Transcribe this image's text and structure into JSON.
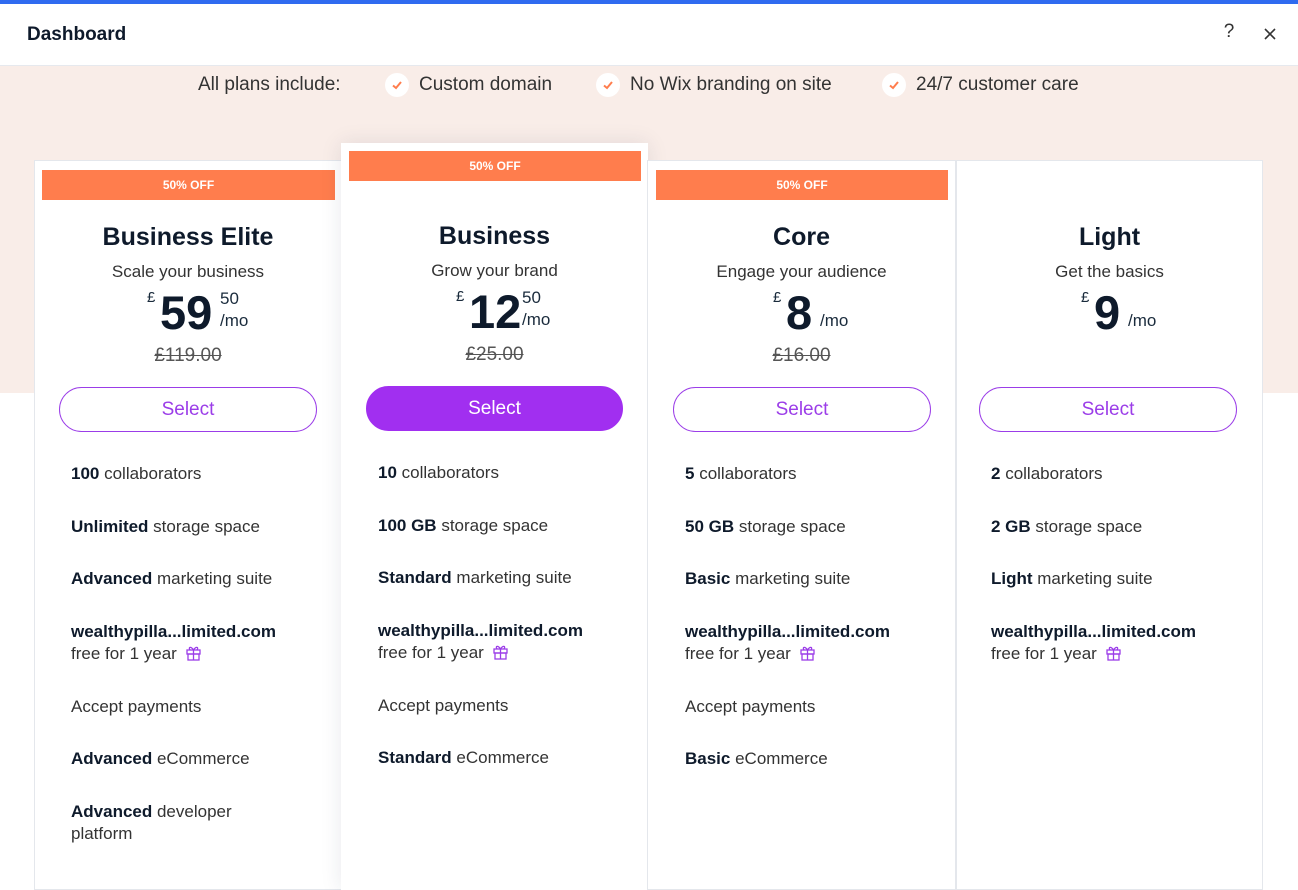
{
  "header": {
    "title": "Dashboard",
    "help": "?"
  },
  "includes": {
    "lead": "All plans include:",
    "items": [
      "Custom domain",
      "No Wix branding on site",
      "24/7 customer care"
    ]
  },
  "colors": {
    "badge": "#ff7d4d",
    "accent": "#a12ff0",
    "hero": "#f9ede8"
  },
  "plans": [
    {
      "badge": "50% OFF",
      "name": "Business Elite",
      "tagline": "Scale your business",
      "currency": "£",
      "price": "59",
      "cents": "50",
      "per": "/mo",
      "old_price": "£119.00",
      "cta": "Select",
      "f1b": "100",
      "f1": " collaborators",
      "f2b": "Unlimited",
      "f2": " storage space",
      "f3b": "Advanced",
      "f3": " marketing suite",
      "domain": "wealthypilla...limited.com",
      "domain_note": "free for 1 year",
      "payments": "Accept payments",
      "f5b": "Advanced",
      "f5": " eCommerce",
      "f6b": "Advanced",
      "f6": " developer platform"
    },
    {
      "badge": "50% OFF",
      "name": "Business",
      "tagline": "Grow your brand",
      "currency": "£",
      "price": "12",
      "cents": "50",
      "per": "/mo",
      "old_price": "£25.00",
      "cta": "Select",
      "f1b": "10",
      "f1": " collaborators",
      "f2b": "100 GB",
      "f2": " storage space",
      "f3b": "Standard",
      "f3": " marketing suite",
      "domain": "wealthypilla...limited.com",
      "domain_note": "free for 1 year",
      "payments": "Accept payments",
      "f5b": "Standard",
      "f5": " eCommerce"
    },
    {
      "badge": "50% OFF",
      "name": "Core",
      "tagline": "Engage your audience",
      "currency": "£",
      "price": "8",
      "per": "/mo",
      "old_price": "£16.00",
      "cta": "Select",
      "f1b": "5",
      "f1": " collaborators",
      "f2b": "50 GB",
      "f2": " storage space",
      "f3b": "Basic",
      "f3": " marketing suite",
      "domain": "wealthypilla...limited.com",
      "domain_note": "free for 1 year",
      "payments": "Accept payments",
      "f5b": "Basic",
      "f5": " eCommerce"
    },
    {
      "name": "Light",
      "tagline": "Get the basics",
      "currency": "£",
      "price": "9",
      "per": "/mo",
      "cta": "Select",
      "f1b": "2",
      "f1": " collaborators",
      "f2b": "2 GB",
      "f2": " storage space",
      "f3b": "Light",
      "f3": " marketing suite",
      "domain": "wealthypilla...limited.com",
      "domain_note": "free for 1 year"
    }
  ]
}
